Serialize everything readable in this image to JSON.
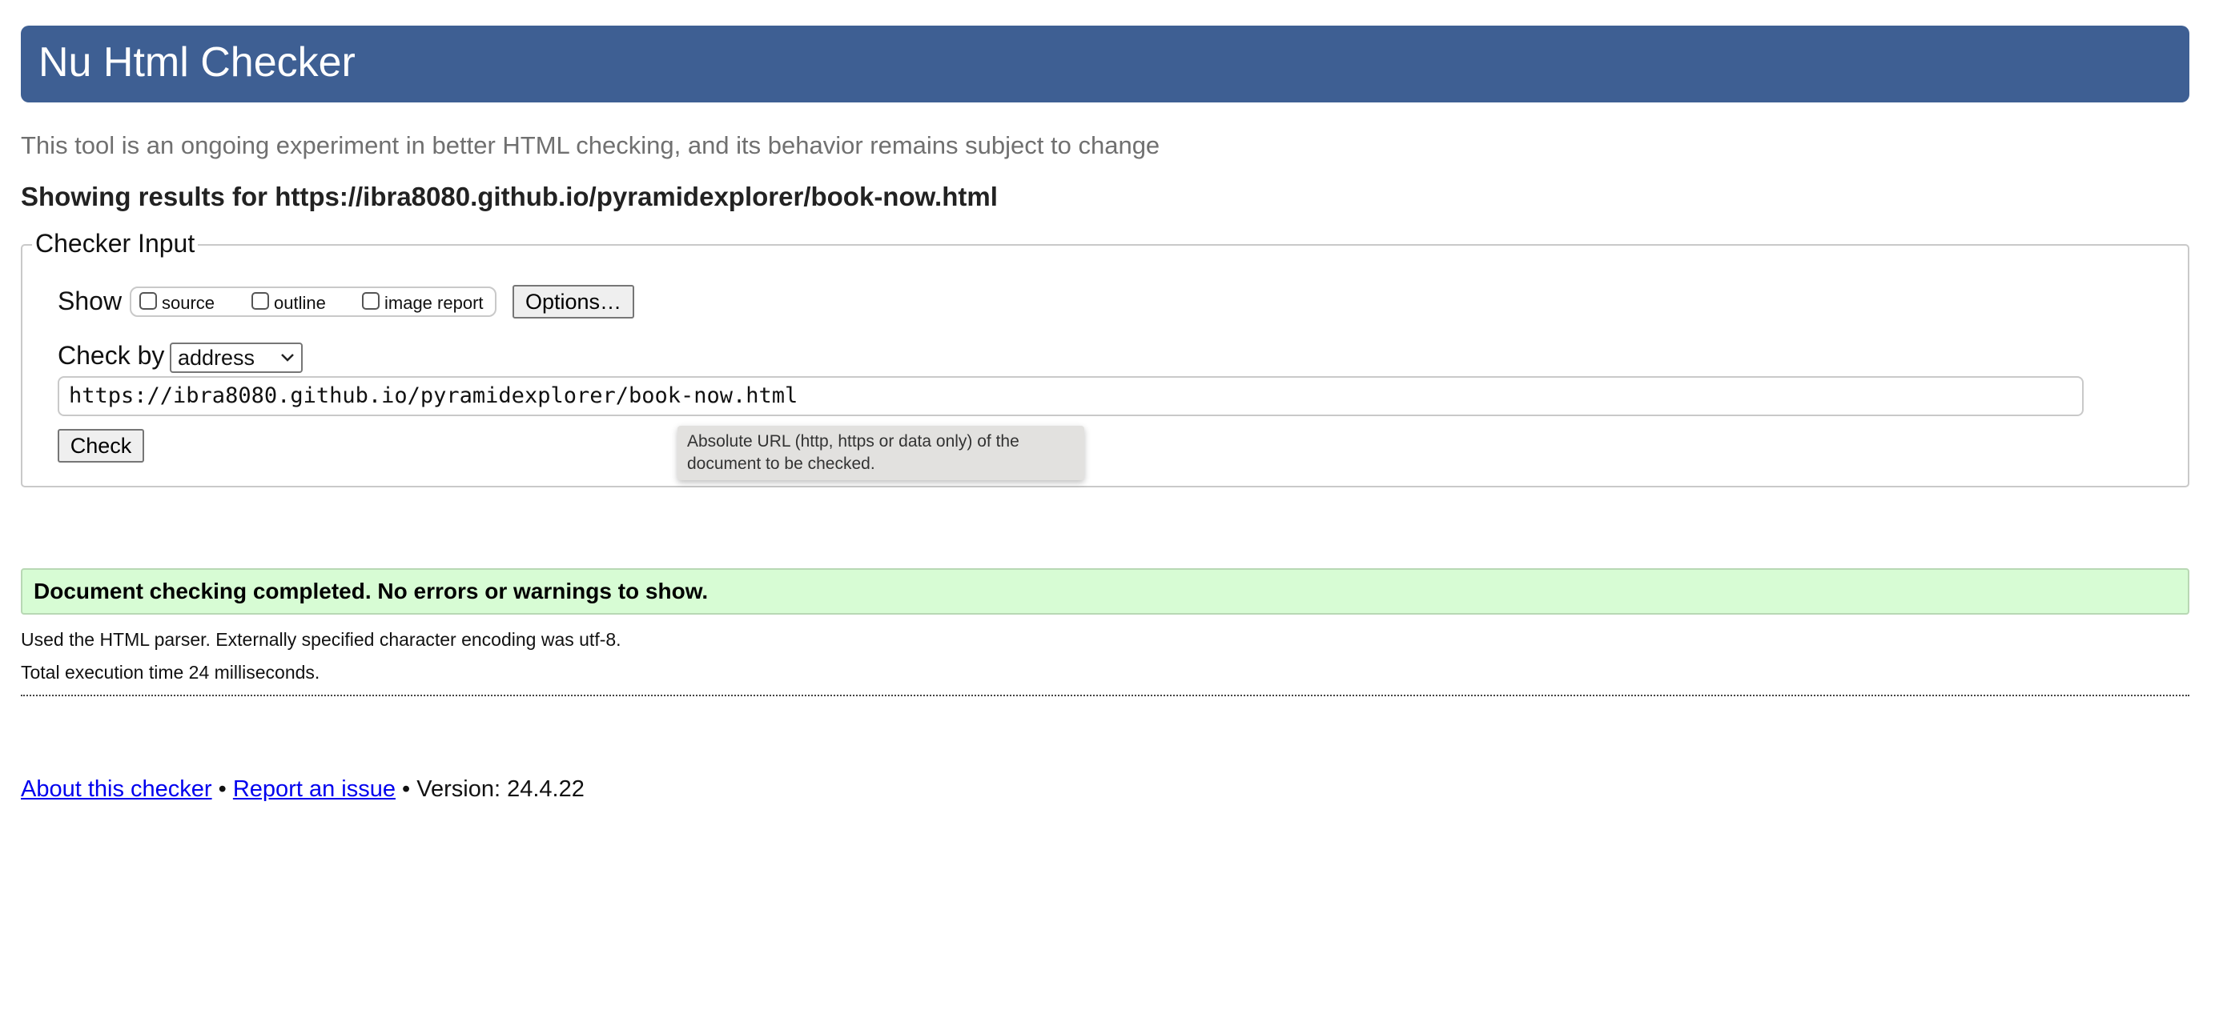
{
  "header": {
    "title": "Nu Html Checker"
  },
  "tagline": "This tool is an ongoing experiment in better HTML checking, and its behavior remains subject to change",
  "showing_results": "Showing results for https://ibra8080.github.io/pyramidexplorer/book-now.html",
  "checker_input": {
    "legend": "Checker Input",
    "show_label": "Show",
    "show_options": [
      {
        "label": "source",
        "checked": false
      },
      {
        "label": "outline",
        "checked": false
      },
      {
        "label": "image report",
        "checked": false
      }
    ],
    "options_button": "Options…",
    "check_by_label": "Check by",
    "check_by_selected": "address",
    "url_value": "https://ibra8080.github.io/pyramidexplorer/book-now.html",
    "check_button": "Check",
    "tooltip": "Absolute URL (http, https or data only) of the document to be checked."
  },
  "results": {
    "status": "Document checking completed. No errors or warnings to show.",
    "status_color": "#d7fcd4",
    "parser_info": "Used the HTML parser. Externally specified character encoding was utf-8.",
    "execution_time": "Total execution time 24 milliseconds."
  },
  "footer": {
    "about_link": "About this checker",
    "separator": "•",
    "report_link": "Report an issue",
    "version": "Version: 24.4.22"
  },
  "colors": {
    "header_bg": "#3e5f93",
    "link": "#0000ee"
  }
}
